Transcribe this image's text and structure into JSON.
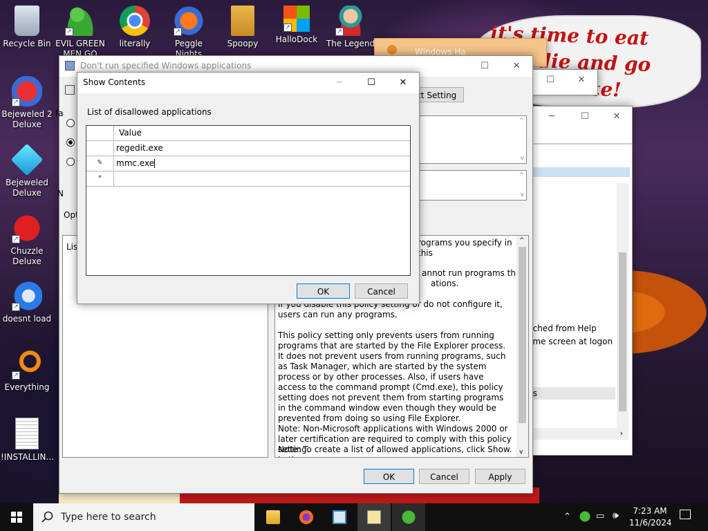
{
  "colors": {
    "accent": "#0078d7",
    "bubble_text": "#c41212",
    "taskbar": "#101010"
  },
  "desktop": {
    "icons": [
      {
        "label": "Recycle Bin",
        "icon": "recycle-bin-icon"
      },
      {
        "label": "EVIL GREEN MEN GO",
        "icon": "green-men-icon"
      },
      {
        "label": "literally",
        "icon": "chrome-icon"
      },
      {
        "label": "Peggle Nights",
        "icon": "peggle-icon"
      },
      {
        "label": "Spoopy",
        "icon": "folder-icon"
      },
      {
        "label": "HalloDock",
        "icon": "windows-logo-icon"
      },
      {
        "label": "The Legend",
        "icon": "game-character-icon"
      },
      {
        "label": "Bejeweled 2 Deluxe",
        "icon": "bejeweled2-icon"
      },
      {
        "label": "Bejeweled Deluxe",
        "icon": "bejeweled-icon"
      },
      {
        "label": "Chuzzle Deluxe",
        "icon": "chuzzle-icon"
      },
      {
        "label": "doesnt load",
        "icon": "thunderbird-icon"
      },
      {
        "label": "Everything",
        "icon": "search-magnifier-icon"
      },
      {
        "label": "!INSTALLIN...",
        "icon": "text-file-icon"
      }
    ],
    "bubble_text": "it's time to eat shit die and go trick d vote!"
  },
  "bg_window": {
    "title": "Windows Ha",
    "partial_label": "Windows Ha"
  },
  "policy_window": {
    "title": "Don't run specified Windows applications",
    "next_setting": "xt Setting",
    "opt_label": "Opt",
    "list_label": "List",
    "side_label": "fa",
    "side_label2": "N",
    "help_line1": "rograms you specify in this",
    "help_line2": "annot run programs that",
    "help_line3": "ations.",
    "help_para1": "If you disable this policy setting or do not configure it, users can run any programs.",
    "help_para2": "This policy setting only prevents users from running programs that are started by the File Explorer process. It does not prevent users from running programs, such as Task Manager, which are started by the system process or by other processes.  Also, if users have access to the command prompt (Cmd.exe), this policy setting does not prevent them from starting programs in the command window even though they would be prevented from doing so using File Explorer.",
    "help_para3": "Note: Non-Microsoft applications with Windows 2000 or later certification are required to comply with this policy setting.",
    "help_para4": "Note: To create a list of allowed applications, click Show.  In the",
    "ok": "OK",
    "cancel": "Cancel",
    "apply": "Apply"
  },
  "right_window": {
    "items": [
      "nched from Help",
      "ome screen at logon",
      "t",
      "ns",
      "s"
    ]
  },
  "show_contents": {
    "title": "Show Contents",
    "list_label": "List of disallowed applications",
    "column_header": "Value",
    "rows": [
      {
        "marker": "",
        "value": "regedit.exe"
      },
      {
        "marker": "✎",
        "value": "mmc.exe"
      },
      {
        "marker": "*",
        "value": ""
      }
    ],
    "ok": "OK",
    "cancel": "Cancel"
  },
  "taskbar": {
    "search_placeholder": "Type here to search",
    "time": "7:23 AM",
    "date": "11/6/2024"
  }
}
